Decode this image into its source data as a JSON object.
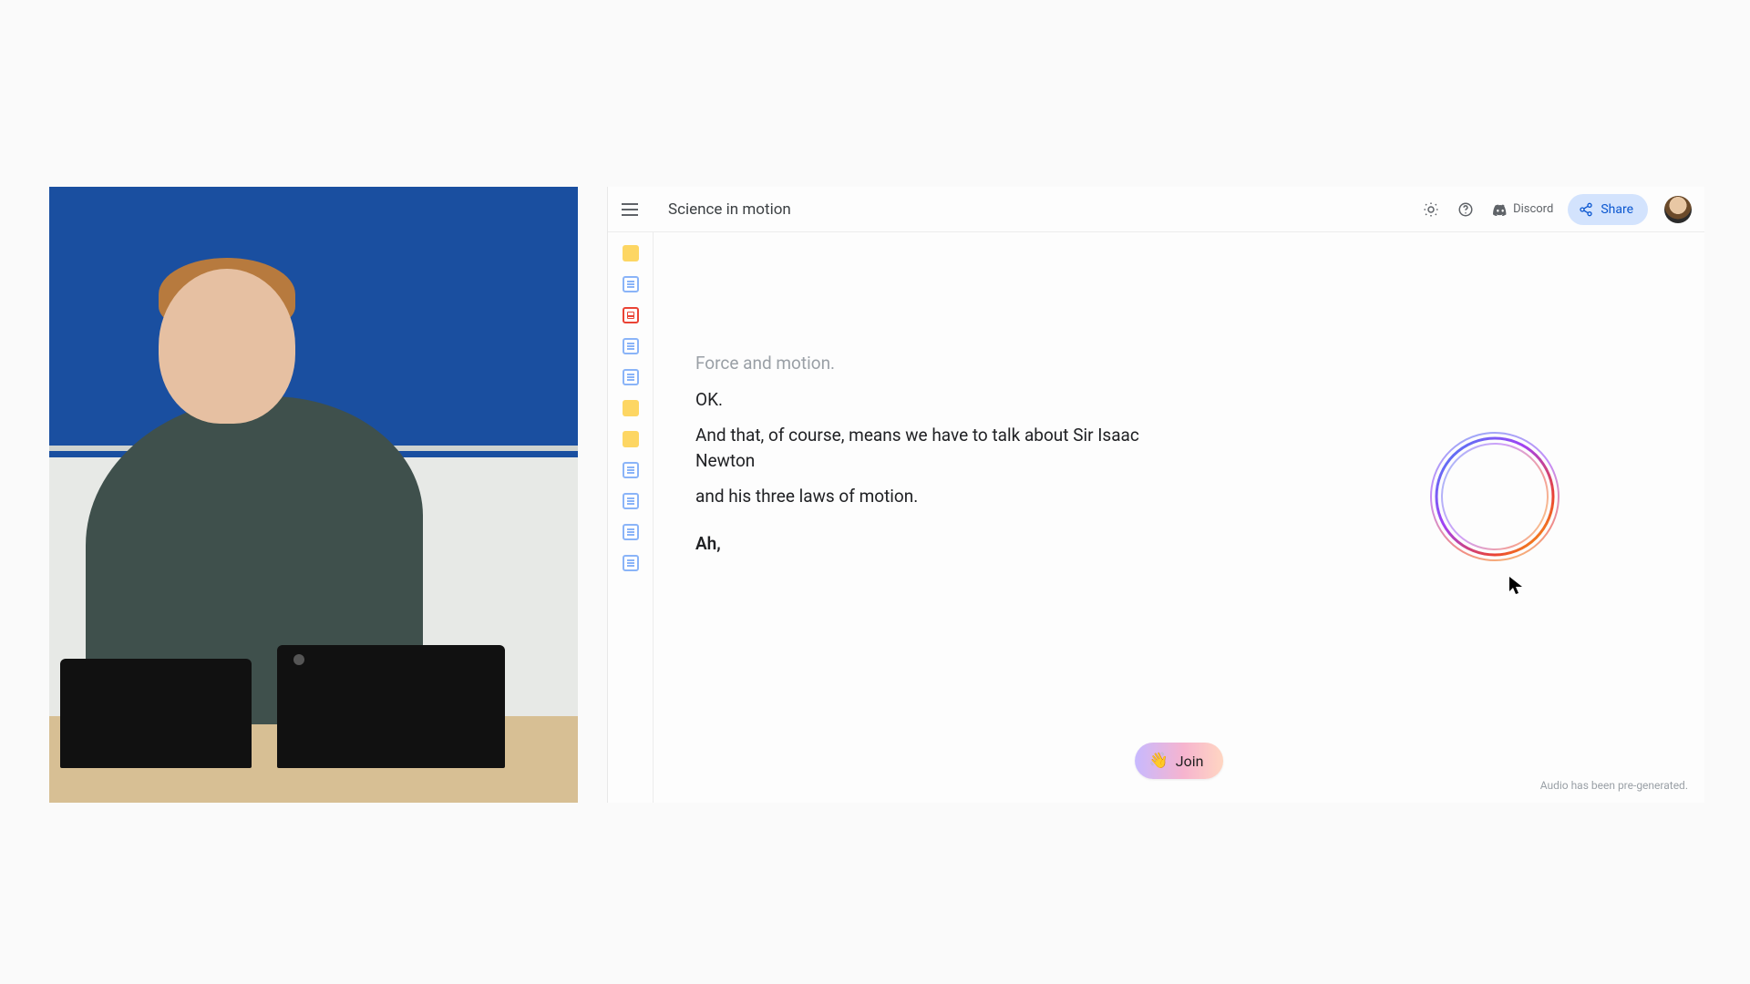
{
  "header": {
    "title": "Science in motion",
    "discord_label": "Discord",
    "share_label": "Share"
  },
  "sources": [
    {
      "kind": "yellow"
    },
    {
      "kind": "blue"
    },
    {
      "kind": "red",
      "active": true
    },
    {
      "kind": "blue"
    },
    {
      "kind": "blue"
    },
    {
      "kind": "yellow"
    },
    {
      "kind": "yellow"
    },
    {
      "kind": "blue"
    },
    {
      "kind": "blue"
    },
    {
      "kind": "blue"
    },
    {
      "kind": "blue"
    }
  ],
  "transcript": {
    "context": "Force and motion.",
    "lines": [
      "OK.",
      "And that, of course, means we have to talk about Sir Isaac Newton",
      "and his three laws of motion."
    ],
    "current": "Ah,"
  },
  "join": {
    "label": "Join",
    "emoji": "👋"
  },
  "footer": {
    "note": "Audio has been pre-generated."
  }
}
